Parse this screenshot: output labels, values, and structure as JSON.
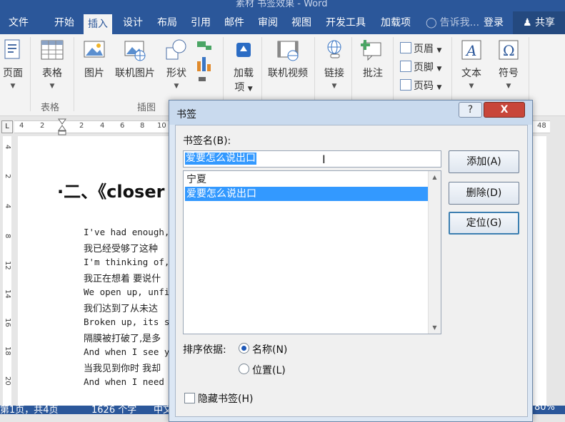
{
  "window": {
    "title": "素材 书签效果 - Word"
  },
  "ribbon_tabs": [
    {
      "label": "文件"
    },
    {
      "label": "开始"
    },
    {
      "label": "插入"
    },
    {
      "label": "设计"
    },
    {
      "label": "布局"
    },
    {
      "label": "引用"
    },
    {
      "label": "邮件"
    },
    {
      "label": "审阅"
    },
    {
      "label": "视图"
    },
    {
      "label": "开发工具"
    },
    {
      "label": "加载项"
    }
  ],
  "active_tab": "插入",
  "tell_me": "告诉我...",
  "login": "登录",
  "share": "共享",
  "ribbon": {
    "page": "页面",
    "table": "表格",
    "picture": "图片",
    "online_picture": "联机图片",
    "shapes": "形状",
    "addins_line1": "加载",
    "addins_line2": "项",
    "online_video": "联机视频",
    "link": "链接",
    "comment": "批注",
    "header": "页眉",
    "footer": "页脚",
    "page_number": "页码",
    "text": "文本",
    "symbol": "符号",
    "group_table": "表格",
    "group_illustrations": "插图"
  },
  "ruler": {
    "numbers": [
      "4",
      "2",
      "2",
      "4",
      "6",
      "8",
      "10",
      "48"
    ]
  },
  "vruler": {
    "numbers": [
      "4",
      "2",
      "4",
      "6",
      "8",
      "10",
      "12",
      "14",
      "16",
      "18",
      "20"
    ]
  },
  "document": {
    "heading": "·二、《closer",
    "lines": [
      "I've had enough,",
      "我已经受够了这种",
      "I'm thinking of,",
      "我正在想着 要说什",
      "We open up, unfin",
      "我们达到了从未达",
      "Broken up, its se",
      "隔膜被打破了,是多",
      "And when I see yo",
      "当我见到你时 我却",
      "And when I need y"
    ]
  },
  "statusbar": {
    "pages": "第1页，共4页",
    "words": "1626 个字",
    "lang": "中文",
    "zoom": "80%"
  },
  "dialog": {
    "title": "书签",
    "name_label": "书签名(B):",
    "name_value": "爱要怎么说出口",
    "bookmarks": [
      "宁夏",
      "爱要怎么说出口"
    ],
    "selected_index": 1,
    "add": "添加(A)",
    "delete": "删除(D)",
    "goto": "定位(G)",
    "sort_label": "排序依据:",
    "sort_name": "名称(N)",
    "sort_location": "位置(L)",
    "sort_selected": "名称",
    "hidden_label": "隐藏书签(H)",
    "help": "?",
    "close": "X"
  },
  "colors": {
    "accent": "#2b579a",
    "selection": "#3399ff",
    "close_button": "#c8463a"
  },
  "icons": [
    "lightbulb-icon",
    "person-add-icon",
    "table-icon",
    "picture-icon",
    "online-picture-icon",
    "shapes-icon",
    "store-icon",
    "video-icon",
    "link-icon",
    "comment-icon",
    "header-icon",
    "footer-icon",
    "page-number-icon",
    "text-icon",
    "omega-icon"
  ]
}
